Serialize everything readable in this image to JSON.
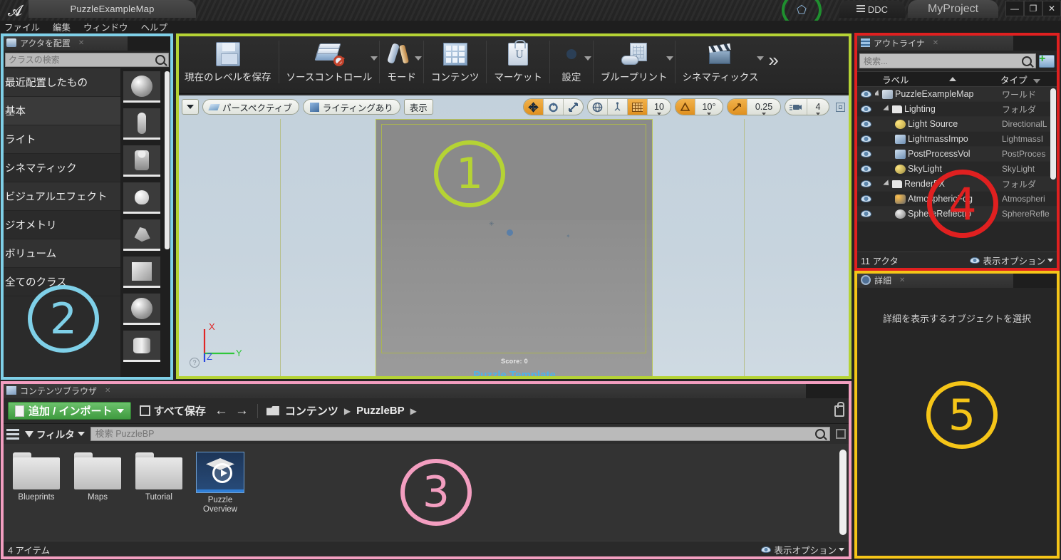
{
  "titlebar": {
    "map_tab": "PuzzleExampleMap",
    "ddc_label": "DDC",
    "project_label": "MyProject",
    "minimize": "—",
    "maximize": "❐",
    "close": "✕"
  },
  "menubar": {
    "items": [
      "ファイル",
      "編集",
      "ウィンドウ",
      "ヘルプ"
    ]
  },
  "place_actors": {
    "title": "アクタを配置",
    "search_placeholder": "クラスの検索",
    "categories": [
      "最近配置したもの",
      "基本",
      "ライト",
      "シネマティック",
      "ビジュアルエフェクト",
      "ジオメトリ",
      "ボリューム",
      "全てのクラス"
    ]
  },
  "toolbar": {
    "items": [
      {
        "label": "現在のレベルを保存",
        "icon": "save-icon",
        "caret": false
      },
      {
        "label": "ソースコントロール",
        "icon": "source-control-icon",
        "caret": true
      },
      {
        "label": "モード",
        "icon": "modes-icon",
        "caret": true
      },
      {
        "label": "コンテンツ",
        "icon": "content-icon",
        "caret": false
      },
      {
        "label": "マーケット",
        "icon": "marketplace-icon",
        "caret": false
      },
      {
        "label": "設定",
        "icon": "settings-icon",
        "caret": true
      },
      {
        "label": "ブループリント",
        "icon": "blueprint-icon",
        "caret": true
      },
      {
        "label": "シネマティックス",
        "icon": "cinematics-icon",
        "caret": true
      }
    ],
    "overflow": "»"
  },
  "viewport": {
    "perspective_label": "パースペクティブ",
    "lighting_label": "ライティングあり",
    "show_label": "表示",
    "grid_snap_value": "10",
    "angle_snap_value": "10°",
    "scale_snap_value": "0.25",
    "camera_speed_value": "4",
    "score_text": "Score: 0",
    "title_text": "Puzzle Template",
    "axis_x": "X",
    "axis_y": "Y",
    "axis_z": "Z",
    "help_glyph": "?"
  },
  "outliner": {
    "title": "アウトライナ",
    "search_placeholder": "検索...",
    "col_label": "ラベル",
    "col_type": "タイプ",
    "rows": [
      {
        "label": "PuzzleExampleMap",
        "type": "ワールド",
        "indent": 0,
        "icon": "world-icon",
        "expander": true
      },
      {
        "label": "Lighting",
        "type": "フォルダ",
        "indent": 1,
        "icon": "folder-icon",
        "expander": true
      },
      {
        "label": "Light Source",
        "type": "DirectionalL",
        "indent": 2,
        "icon": "light-icon",
        "expander": false
      },
      {
        "label": "LightmassImpo",
        "type": "LightmassI",
        "indent": 2,
        "icon": "volume-icon",
        "expander": false
      },
      {
        "label": "PostProcessVol",
        "type": "PostProces",
        "indent": 2,
        "icon": "volume-icon",
        "expander": false
      },
      {
        "label": "SkyLight",
        "type": "SkyLight",
        "indent": 2,
        "icon": "skylight-icon",
        "expander": false
      },
      {
        "label": "RenderFX",
        "type": "フォルダ",
        "indent": 1,
        "icon": "folder-icon",
        "expander": true
      },
      {
        "label": "AtmosphericFog",
        "type": "Atmospheri",
        "indent": 2,
        "icon": "fog-icon",
        "expander": false
      },
      {
        "label": "SphereReflectio",
        "type": "SphereRefle",
        "indent": 2,
        "icon": "sphere-icon",
        "expander": false
      }
    ],
    "footer_count": "11 アクタ",
    "footer_view_options": "表示オプション"
  },
  "details": {
    "title": "詳細",
    "empty_message": "詳細を表示するオブジェクトを選択"
  },
  "content_browser": {
    "title": "コンテンツブラウザ",
    "add_import_label": "追加 / インポート",
    "save_all_label": "すべて保存",
    "back_arrow": "←",
    "forward_arrow": "→",
    "breadcrumbs": [
      "コンテンツ",
      "PuzzleBP"
    ],
    "crumb_sep": "▶",
    "filter_label": "フィルタ",
    "search_placeholder": "検索 PuzzleBP",
    "assets": [
      {
        "name": "Blueprints",
        "kind": "folder"
      },
      {
        "name": "Maps",
        "kind": "folder"
      },
      {
        "name": "Tutorial",
        "kind": "folder"
      },
      {
        "name": "Puzzle\nOverview",
        "kind": "asset",
        "selected": true
      }
    ],
    "footer_count": "4 アイテム",
    "footer_view_options": "表示オプション"
  },
  "annotations": [
    {
      "number": "①",
      "color": "#b5d334",
      "target": "viewport"
    },
    {
      "number": "②",
      "color": "#7fd0e8",
      "target": "place-actors"
    },
    {
      "number": "③",
      "color": "#f39ec0",
      "target": "content-browser"
    },
    {
      "number": "④",
      "color": "#e02020",
      "target": "outliner"
    },
    {
      "number": "⑤",
      "color": "#f5c518",
      "target": "details"
    }
  ],
  "colors": {
    "annotation_1": "#b5d334",
    "annotation_2": "#7fd0e8",
    "annotation_3": "#f39ec0",
    "annotation_4": "#e02020",
    "annotation_5": "#f5c518",
    "accent_orange": "#e09a25",
    "add_green": "#4fa350"
  }
}
